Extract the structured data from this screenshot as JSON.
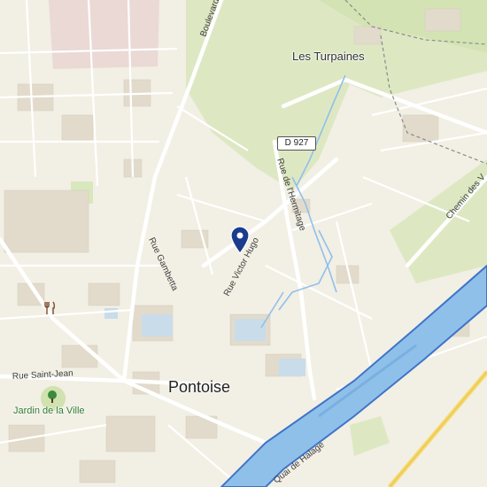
{
  "map": {
    "city": "Pontoise",
    "places": {
      "les_turpaines": "Les Turpaines",
      "jardin": "Jardin de la Ville"
    },
    "roads": {
      "boulevard": "Boulevard",
      "rue_gambetta": "Rue Gambetta",
      "rue_victor_hugo": "Rue Victor Hugo",
      "rue_hermitage": "Rue de l'Hermitage",
      "chemin": "Chemin des V",
      "rue_saint_jean": "Rue Saint-Jean",
      "quai": "Quai de Halage"
    },
    "route_shield": "D 927",
    "colors": {
      "land": "#f2efe4",
      "green": "#d9e7bd",
      "water": "#8fc0ea",
      "river_edge": "#3f74c8",
      "building": "#e3dccd",
      "pin": "#1b3b8e",
      "road_yellow": "#f6d86b"
    },
    "icons": {
      "restaurant": "restaurant-icon",
      "park": "tree-icon",
      "marker": "location-pin-icon"
    }
  }
}
